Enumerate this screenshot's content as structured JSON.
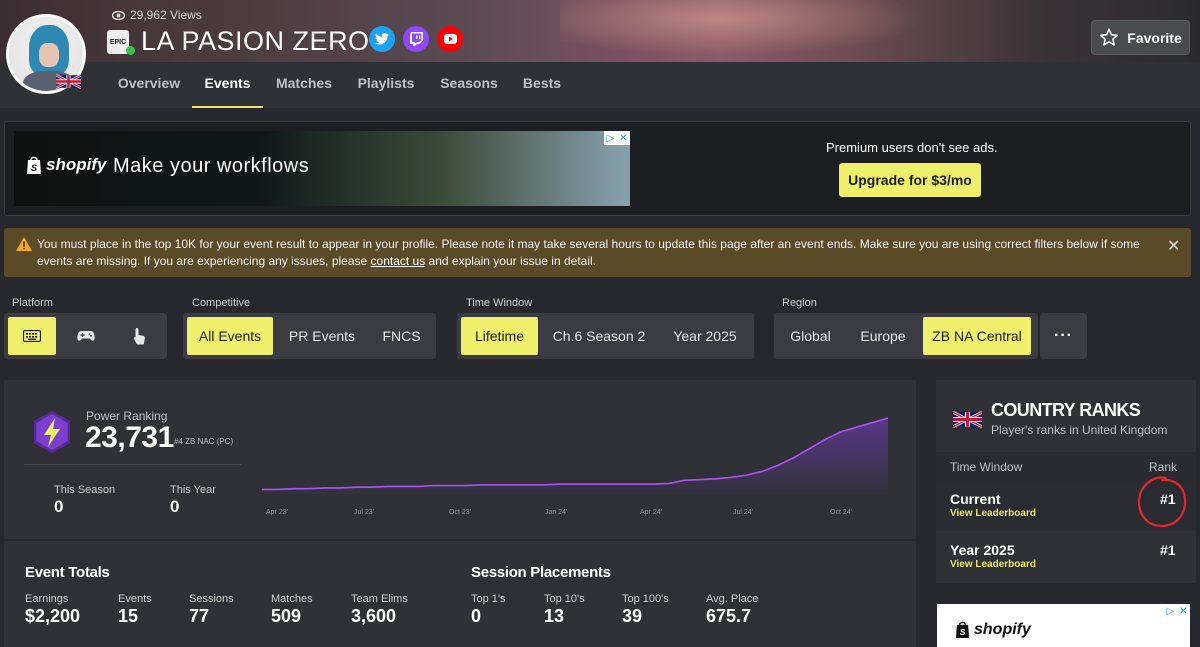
{
  "profile": {
    "views": "29,962 Views",
    "name": "LA PASION ZERO",
    "epic_badge": "EPIC",
    "favorite_label": "Favorite",
    "socials": [
      "twitter-icon",
      "twitch-icon",
      "youtube-icon"
    ]
  },
  "nav": {
    "tabs": [
      "Overview",
      "Events",
      "Matches",
      "Playlists",
      "Seasons",
      "Bests"
    ],
    "active": "Events"
  },
  "ad": {
    "brand": "shopify",
    "headline": "Make your workflows",
    "premium_text": "Premium users don't see ads.",
    "upgrade_label": "Upgrade for $3/mo"
  },
  "alert": {
    "text_before": "You must place in the top 10K for your event result to appear in your profile. Please note it may take several hours to update this page after an event ends. Make sure you are using correct filters below if some events are missing. If you are experiencing any issues, please ",
    "link_text": "contact us",
    "text_after": " and explain your issue in detail."
  },
  "filters": {
    "platform": {
      "label": "Platform",
      "options": [
        "keyboard-icon",
        "gamepad-icon",
        "touch-icon"
      ],
      "active": "keyboard-icon"
    },
    "competitive": {
      "label": "Competitive",
      "options": [
        "All Events",
        "PR Events",
        "FNCS"
      ],
      "active": "All Events"
    },
    "time_window": {
      "label": "Time Window",
      "options": [
        "Lifetime",
        "Ch.6 Season 2",
        "Year 2025"
      ],
      "active": "Lifetime"
    },
    "region": {
      "label": "Region",
      "options": [
        "Global",
        "Europe",
        "ZB NA Central"
      ],
      "active": "ZB NA Central"
    },
    "more_label": "···"
  },
  "power_ranking": {
    "label": "Power Ranking",
    "value": "23,731",
    "sub": "#4 ZB NAC (PC)",
    "this_season_label": "This Season",
    "this_season_value": "0",
    "this_year_label": "This Year",
    "this_year_value": "0"
  },
  "chart_data": {
    "type": "line",
    "x_ticks": [
      "Apr 23'",
      "Jul 23'",
      "Oct 23'",
      "Jan 24'",
      "Apr 24'",
      "Jul 24'",
      "Oct 24'"
    ],
    "x": [
      0,
      1,
      2,
      3,
      4,
      5,
      6,
      7,
      8,
      9,
      10,
      11,
      12,
      13,
      14,
      15,
      16,
      17,
      18,
      19,
      20,
      21,
      22,
      23,
      24,
      25,
      26,
      27,
      28,
      29,
      30,
      31,
      32,
      33,
      34,
      35,
      36,
      37,
      38,
      39,
      40
    ],
    "y": [
      0.06,
      0.06,
      0.07,
      0.07,
      0.08,
      0.08,
      0.09,
      0.09,
      0.1,
      0.1,
      0.1,
      0.11,
      0.11,
      0.11,
      0.12,
      0.12,
      0.12,
      0.12,
      0.12,
      0.13,
      0.13,
      0.13,
      0.13,
      0.13,
      0.13,
      0.13,
      0.14,
      0.18,
      0.19,
      0.2,
      0.22,
      0.25,
      0.3,
      0.38,
      0.48,
      0.6,
      0.72,
      0.82,
      0.88,
      0.94,
      1.0
    ],
    "series_color": "#a855f7",
    "grid": false
  },
  "event_totals": {
    "title": "Event Totals",
    "items": [
      {
        "label": "Earnings",
        "value": "$2,200"
      },
      {
        "label": "Events",
        "value": "15"
      },
      {
        "label": "Sessions",
        "value": "77"
      },
      {
        "label": "Matches",
        "value": "509"
      },
      {
        "label": "Team Elims",
        "value": "3,600"
      }
    ]
  },
  "session_placements": {
    "title": "Session Placements",
    "items": [
      {
        "label": "Top 1's",
        "value": "0"
      },
      {
        "label": "Top 10's",
        "value": "13"
      },
      {
        "label": "Top 100's",
        "value": "39"
      },
      {
        "label": "Avg. Place",
        "value": "675.7"
      }
    ]
  },
  "country_ranks": {
    "title": "COUNTRY RANKS",
    "subtitle": "Player's ranks in United Kingdom",
    "col_window": "Time Window",
    "col_rank": "Rank",
    "rows": [
      {
        "window": "Current",
        "link": "View Leaderboard",
        "rank": "#1"
      },
      {
        "window": "Year 2025",
        "link": "View Leaderboard",
        "rank": "#1"
      }
    ]
  },
  "ad2": {
    "brand": "shopify"
  },
  "colors": {
    "accent": "#f0ef6c",
    "purple": "#a855f7",
    "alert": "#5b4a28"
  }
}
